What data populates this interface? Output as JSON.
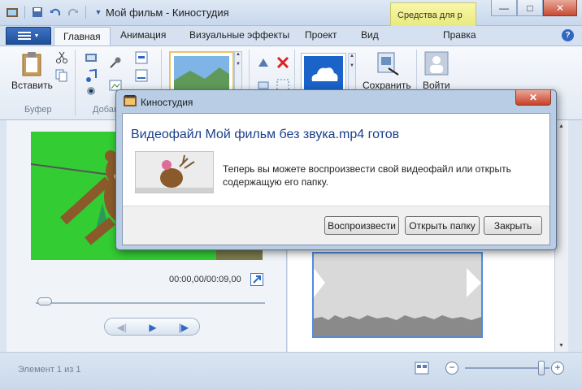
{
  "window": {
    "title": "Мой фильм - Киностудия",
    "context_tab": "Средства для р"
  },
  "tabs": [
    "Главная",
    "Анимация",
    "Визуальные эффекты",
    "Проект",
    "Вид",
    "Правка"
  ],
  "ribbon": {
    "paste_label": "Вставить",
    "group_clipboard": "Буфер",
    "group_add_partial": "Добав",
    "save_label": "Сохранить",
    "signin_label": "Войти"
  },
  "preview": {
    "timecode": "00:00,00/00:09,00"
  },
  "status": {
    "text": "Элемент 1 из 1"
  },
  "dialog": {
    "title": "Киностудия",
    "heading": "Видеофайл Мой фильм без звука.mp4 готов",
    "message": "Теперь вы можете воспроизвести свой видеофайл или открыть содержащую его папку.",
    "buttons": {
      "play": "Воспроизвести",
      "open_folder": "Открыть папку",
      "close": "Закрыть"
    }
  },
  "colors": {
    "accent": "#2e68c0",
    "dialog_heading": "#1a3f8a",
    "video_bg": "#33cc33"
  }
}
